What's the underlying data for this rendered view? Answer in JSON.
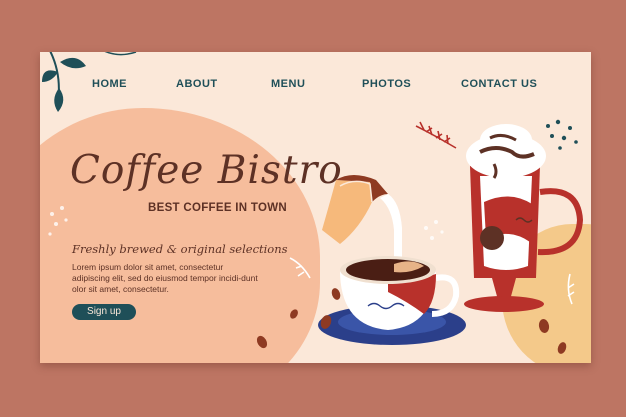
{
  "nav": {
    "items": [
      "HOME",
      "ABOUT",
      "MENU",
      "PHOTOS",
      "CONTACT US"
    ]
  },
  "hero": {
    "title": "Coffee Bistro",
    "subtitle": "BEST COFFEE IN TOWN",
    "tagline": "Freshly brewed & original selections",
    "body": "Lorem ipsum dolor sit amet, consectetur adipiscing elit, sed do eiusmod tempor incidi-dunt olor sit amet, consectetur.",
    "cta_label": "Sign up"
  },
  "colors": {
    "page_background": "#bd7563",
    "card_background": "#fbe8d9",
    "accent_teal": "#1f4f58",
    "text_brown": "#5d3125",
    "peach": "#f6bd9c",
    "mug_red": "#b8312b",
    "saucer_blue": "#2b3f8a"
  },
  "illustrations": [
    "leaf-branch-icon",
    "milk-jug-icon",
    "coffee-cup-icon",
    "saucer-icon",
    "latte-glass-icon",
    "coffee-bean-icon",
    "sprig-icon"
  ]
}
